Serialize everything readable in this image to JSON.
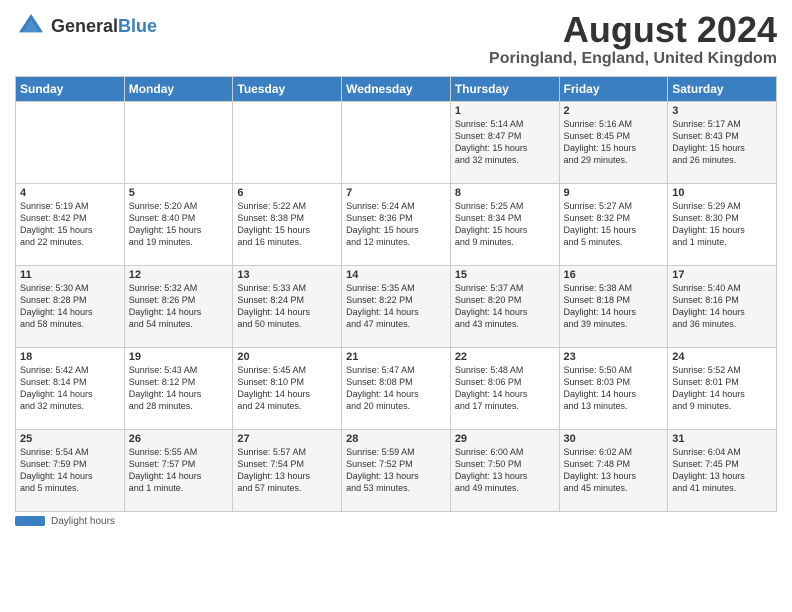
{
  "header": {
    "logo_general": "General",
    "logo_blue": "Blue",
    "month_title": "August 2024",
    "location": "Poringland, England, United Kingdom"
  },
  "days_of_week": [
    "Sunday",
    "Monday",
    "Tuesday",
    "Wednesday",
    "Thursday",
    "Friday",
    "Saturday"
  ],
  "weeks": [
    [
      {
        "day": "",
        "info": ""
      },
      {
        "day": "",
        "info": ""
      },
      {
        "day": "",
        "info": ""
      },
      {
        "day": "",
        "info": ""
      },
      {
        "day": "1",
        "info": "Sunrise: 5:14 AM\nSunset: 8:47 PM\nDaylight: 15 hours\nand 32 minutes."
      },
      {
        "day": "2",
        "info": "Sunrise: 5:16 AM\nSunset: 8:45 PM\nDaylight: 15 hours\nand 29 minutes."
      },
      {
        "day": "3",
        "info": "Sunrise: 5:17 AM\nSunset: 8:43 PM\nDaylight: 15 hours\nand 26 minutes."
      }
    ],
    [
      {
        "day": "4",
        "info": "Sunrise: 5:19 AM\nSunset: 8:42 PM\nDaylight: 15 hours\nand 22 minutes."
      },
      {
        "day": "5",
        "info": "Sunrise: 5:20 AM\nSunset: 8:40 PM\nDaylight: 15 hours\nand 19 minutes."
      },
      {
        "day": "6",
        "info": "Sunrise: 5:22 AM\nSunset: 8:38 PM\nDaylight: 15 hours\nand 16 minutes."
      },
      {
        "day": "7",
        "info": "Sunrise: 5:24 AM\nSunset: 8:36 PM\nDaylight: 15 hours\nand 12 minutes."
      },
      {
        "day": "8",
        "info": "Sunrise: 5:25 AM\nSunset: 8:34 PM\nDaylight: 15 hours\nand 9 minutes."
      },
      {
        "day": "9",
        "info": "Sunrise: 5:27 AM\nSunset: 8:32 PM\nDaylight: 15 hours\nand 5 minutes."
      },
      {
        "day": "10",
        "info": "Sunrise: 5:29 AM\nSunset: 8:30 PM\nDaylight: 15 hours\nand 1 minute."
      }
    ],
    [
      {
        "day": "11",
        "info": "Sunrise: 5:30 AM\nSunset: 8:28 PM\nDaylight: 14 hours\nand 58 minutes."
      },
      {
        "day": "12",
        "info": "Sunrise: 5:32 AM\nSunset: 8:26 PM\nDaylight: 14 hours\nand 54 minutes."
      },
      {
        "day": "13",
        "info": "Sunrise: 5:33 AM\nSunset: 8:24 PM\nDaylight: 14 hours\nand 50 minutes."
      },
      {
        "day": "14",
        "info": "Sunrise: 5:35 AM\nSunset: 8:22 PM\nDaylight: 14 hours\nand 47 minutes."
      },
      {
        "day": "15",
        "info": "Sunrise: 5:37 AM\nSunset: 8:20 PM\nDaylight: 14 hours\nand 43 minutes."
      },
      {
        "day": "16",
        "info": "Sunrise: 5:38 AM\nSunset: 8:18 PM\nDaylight: 14 hours\nand 39 minutes."
      },
      {
        "day": "17",
        "info": "Sunrise: 5:40 AM\nSunset: 8:16 PM\nDaylight: 14 hours\nand 36 minutes."
      }
    ],
    [
      {
        "day": "18",
        "info": "Sunrise: 5:42 AM\nSunset: 8:14 PM\nDaylight: 14 hours\nand 32 minutes."
      },
      {
        "day": "19",
        "info": "Sunrise: 5:43 AM\nSunset: 8:12 PM\nDaylight: 14 hours\nand 28 minutes."
      },
      {
        "day": "20",
        "info": "Sunrise: 5:45 AM\nSunset: 8:10 PM\nDaylight: 14 hours\nand 24 minutes."
      },
      {
        "day": "21",
        "info": "Sunrise: 5:47 AM\nSunset: 8:08 PM\nDaylight: 14 hours\nand 20 minutes."
      },
      {
        "day": "22",
        "info": "Sunrise: 5:48 AM\nSunset: 8:06 PM\nDaylight: 14 hours\nand 17 minutes."
      },
      {
        "day": "23",
        "info": "Sunrise: 5:50 AM\nSunset: 8:03 PM\nDaylight: 14 hours\nand 13 minutes."
      },
      {
        "day": "24",
        "info": "Sunrise: 5:52 AM\nSunset: 8:01 PM\nDaylight: 14 hours\nand 9 minutes."
      }
    ],
    [
      {
        "day": "25",
        "info": "Sunrise: 5:54 AM\nSunset: 7:59 PM\nDaylight: 14 hours\nand 5 minutes."
      },
      {
        "day": "26",
        "info": "Sunrise: 5:55 AM\nSunset: 7:57 PM\nDaylight: 14 hours\nand 1 minute."
      },
      {
        "day": "27",
        "info": "Sunrise: 5:57 AM\nSunset: 7:54 PM\nDaylight: 13 hours\nand 57 minutes."
      },
      {
        "day": "28",
        "info": "Sunrise: 5:59 AM\nSunset: 7:52 PM\nDaylight: 13 hours\nand 53 minutes."
      },
      {
        "day": "29",
        "info": "Sunrise: 6:00 AM\nSunset: 7:50 PM\nDaylight: 13 hours\nand 49 minutes."
      },
      {
        "day": "30",
        "info": "Sunrise: 6:02 AM\nSunset: 7:48 PM\nDaylight: 13 hours\nand 45 minutes."
      },
      {
        "day": "31",
        "info": "Sunrise: 6:04 AM\nSunset: 7:45 PM\nDaylight: 13 hours\nand 41 minutes."
      }
    ]
  ],
  "footer": {
    "daylight_label": "Daylight hours"
  }
}
